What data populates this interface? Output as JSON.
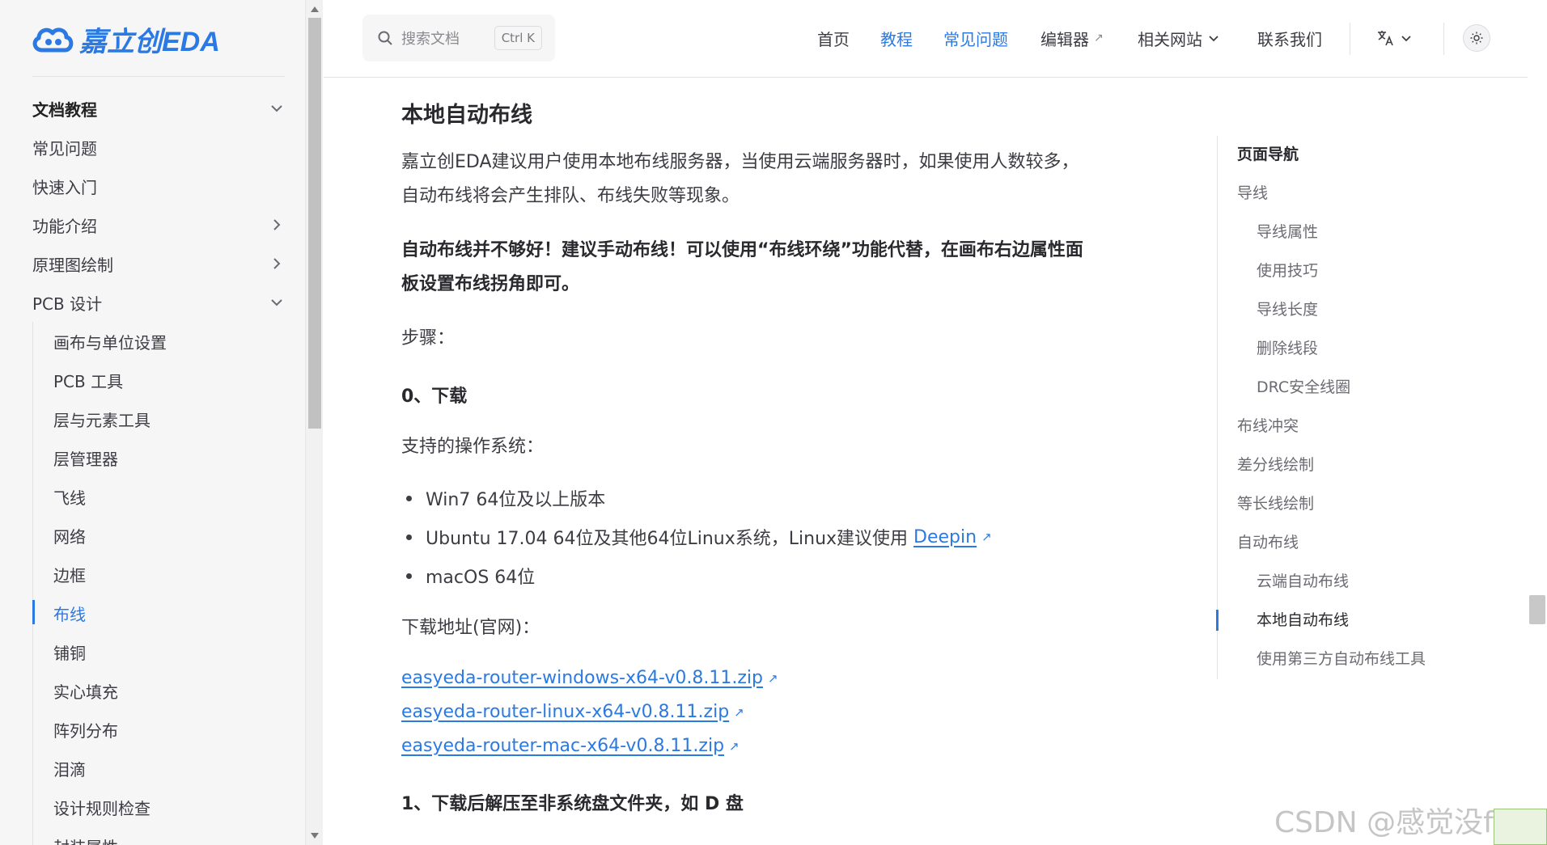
{
  "logo": {
    "text": "嘉立创EDA",
    "brand_color": "#2b7ae3"
  },
  "sidebar": {
    "top_items": [
      {
        "label": "文档教程",
        "expanded": true
      },
      {
        "label": "常见问题"
      },
      {
        "label": "快速入门"
      },
      {
        "label": "功能介绍",
        "expandable": true
      },
      {
        "label": "原理图绘制",
        "expandable": true
      },
      {
        "label": "PCB 设计",
        "expanded": true
      }
    ],
    "pcb_items": [
      "画布与单位设置",
      "PCB 工具",
      "层与元素工具",
      "层管理器",
      "飞线",
      "网络",
      "边框",
      "布线",
      "铺铜",
      "实心填充",
      "阵列分布",
      "泪滴",
      "设计规则检查",
      "封装属性"
    ],
    "active_item": "布线"
  },
  "search": {
    "placeholder": "搜索文档",
    "shortcut": "Ctrl K"
  },
  "topnav": {
    "home": "首页",
    "tutorial": "教程",
    "faq": "常见问题",
    "editor": "编辑器",
    "editor_ext": "↗",
    "sites": "相关网站",
    "contact": "联系我们",
    "lang_icon": "translate-icon",
    "theme_icon": "sun-icon"
  },
  "article": {
    "heading": "本地自动布线",
    "p1_line1": "嘉立创EDA建议用户使用本地布线服务器，当使用云端服务器时，如果使用人数较多，",
    "p1_line2": "自动布线将会产生排队、布线失败等现象。",
    "warn_line1": "自动布线并不够好！建议手动布线！可以使用“布线环绕”功能代替，在画布右边属性面",
    "warn_line2": "板设置布线拐角即可。",
    "steps_label": "步骤：",
    "step0": "0、下载",
    "os_label": "支持的操作系统：",
    "os1": "Win7 64位及以上版本",
    "os2_prefix": "Ubuntu 17.04 64位及其他64位Linux系统，Linux建议使用 ",
    "os2_link": "Deepin",
    "os3": "macOS 64位",
    "download_label": "下载地址(官网)：",
    "downloads": [
      "easyeda-router-windows-x64-v0.8.11.zip",
      "easyeda-router-linux-x64-v0.8.11.zip",
      "easyeda-router-mac-x64-v0.8.11.zip"
    ],
    "ext_arrow": "↗",
    "step1": "1、下载后解压至非系统盘文件夹，如 D 盘"
  },
  "outline": {
    "title": "页面导航",
    "items": [
      {
        "label": "导线",
        "level": 1
      },
      {
        "label": "导线属性",
        "level": 2
      },
      {
        "label": "使用技巧",
        "level": 2
      },
      {
        "label": "导线长度",
        "level": 2
      },
      {
        "label": "删除线段",
        "level": 2
      },
      {
        "label": "DRC安全线圈",
        "level": 2
      },
      {
        "label": "布线冲突",
        "level": 1
      },
      {
        "label": "差分线绘制",
        "level": 1
      },
      {
        "label": "等长线绘制",
        "level": 1
      },
      {
        "label": "自动布线",
        "level": 1
      },
      {
        "label": "云端自动布线",
        "level": 2
      },
      {
        "label": "本地自动布线",
        "level": 2,
        "active": true
      },
      {
        "label": "使用第三方自动布线工具",
        "level": 2
      }
    ]
  },
  "watermark": "CSDN @感觉没feel"
}
